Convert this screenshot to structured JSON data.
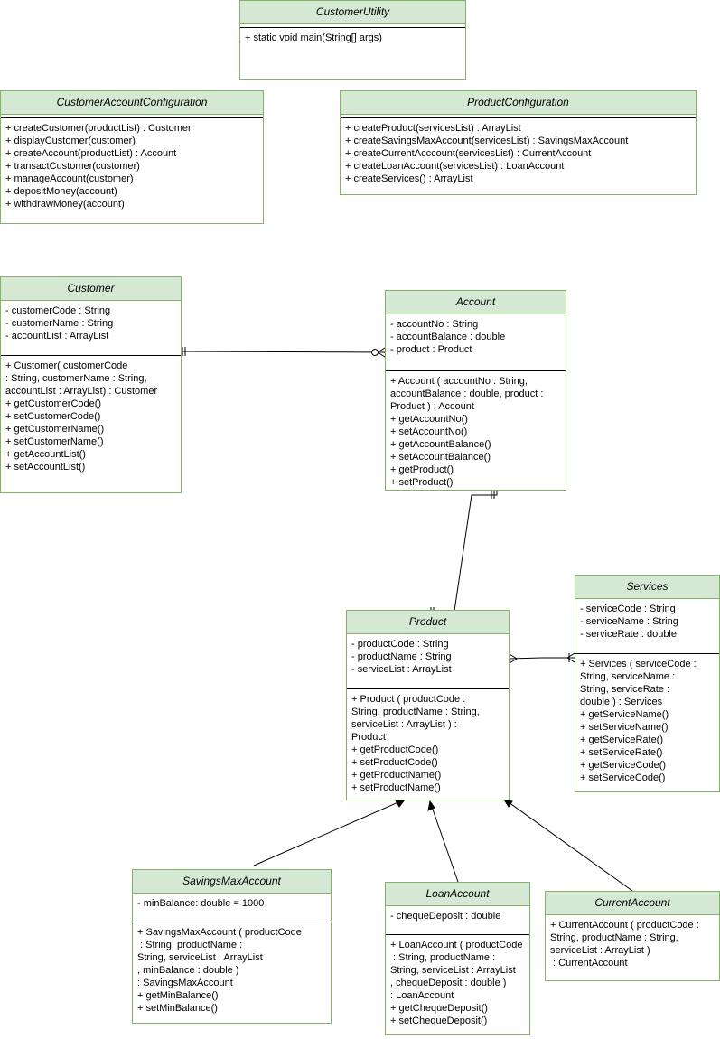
{
  "classes": {
    "customer_utility": {
      "name": "CustomerUtility",
      "attributes": [],
      "operations": [
        "+ static void main(String[] args)"
      ]
    },
    "customer_account_configuration": {
      "name": "CustomerAccountConfiguration",
      "attributes": [],
      "operations": [
        "+ createCustomer(productList) : Customer",
        "+ displayCustomer(customer)",
        "+ createAccount(productList) : Account",
        "+ transactCustomer(customer)",
        "+ manageAccount(customer)",
        "+ depositMoney(account)",
        "+ withdrawMoney(account)"
      ]
    },
    "product_configuration": {
      "name": "ProductConfiguration",
      "attributes": [],
      "operations": [
        "+ createProduct(servicesList) : ArrayList",
        "+ createSavingsMaxAccount(servicesList) : SavingsMaxAccount",
        "+ createCurrentAcccount(servicesList) : CurrentAccount",
        "+ createLoanAccount(servicesList) : LoanAccount",
        "+ createServices() : ArrayList"
      ]
    },
    "customer": {
      "name": "Customer",
      "attributes": [
        "- customerCode : String",
        "- customerName : String",
        "- accountList : ArrayList"
      ],
      "operations": [
        "+ Customer( customerCode",
        ": String, customerName : String,",
        "accountList : ArrayList) : Customer",
        "+ getCustomerCode()",
        "+ setCustomerCode()",
        "+ getCustomerName()",
        "+ setCustomerName()",
        "+ getAccountList()",
        "+ setAccountList()"
      ]
    },
    "account": {
      "name": "Account",
      "attributes": [
        "- accountNo : String",
        "- accountBalance : double",
        "- product : Product"
      ],
      "operations": [
        "+ Account ( accountNo : String,",
        "accountBalance : double, product :",
        "Product ) : Account",
        "+ getAccountNo()",
        "+ setAccountNo()",
        "+ getAccountBalance()",
        "+ setAccountBalance()",
        "+ getProduct()",
        "+ setProduct()"
      ]
    },
    "services": {
      "name": "Services",
      "attributes": [
        "- serviceCode : String",
        "- serviceName : String",
        "- serviceRate : double"
      ],
      "operations": [
        "+ Services ( serviceCode :",
        "String, serviceName :",
        "String, serviceRate :",
        "double ) : Services",
        "+ getServiceName()",
        "+ setServiceName()",
        "+ getServiceRate()",
        "+ setServiceRate()",
        "+ getServiceCode()",
        "+ setServiceCode()"
      ]
    },
    "product": {
      "name": "Product",
      "attributes": [
        "- productCode : String",
        "- productName : String",
        "- serviceList : ArrayList"
      ],
      "operations": [
        "+ Product ( productCode :",
        "String, productName : String,",
        "serviceList : ArrayList ) :",
        "Product",
        "+ getProductCode()",
        "+ setProductCode()",
        "+ getProductName()",
        "+ setProductName()"
      ]
    },
    "savings_max_account": {
      "name": "SavingsMaxAccount",
      "attributes": [
        "- minBalance: double = 1000"
      ],
      "operations": [
        "+ SavingsMaxAccount ( productCode",
        " : String, productName :",
        "String, serviceList : ArrayList",
        ", minBalance : double )",
        ": SavingsMaxAccount",
        "+ getMinBalance()",
        "+ setMinBalance()"
      ]
    },
    "loan_account": {
      "name": "LoanAccount",
      "attributes": [
        "- chequeDeposit : double"
      ],
      "operations": [
        "+ LoanAccount ( productCode",
        " : String, productName :",
        "String, serviceList : ArrayList",
        ", chequeDeposit : double )",
        ": LoanAccount",
        "+ getChequeDeposit()",
        "+ setChequeDeposit()"
      ]
    },
    "current_account": {
      "name": "CurrentAccount",
      "attributes": [],
      "operations": [
        "+ CurrentAccount ( productCode :",
        "String, productName : String,",
        "serviceList : ArrayList )",
        " : CurrentAccount"
      ]
    }
  },
  "relationships": [
    {
      "from": "Customer",
      "to": "Account",
      "from_end": "one-and-only-one",
      "to_end": "zero-or-many"
    },
    {
      "from": "Account",
      "to": "Product",
      "from_end": "one-and-only-one",
      "to_end": "one-and-only-one"
    },
    {
      "from": "Product",
      "to": "Services",
      "from_end": "many",
      "to_end": "one-or-many"
    },
    {
      "from": "SavingsMaxAccount",
      "to": "Product",
      "type": "generalization"
    },
    {
      "from": "LoanAccount",
      "to": "Product",
      "type": "generalization"
    },
    {
      "from": "CurrentAccount",
      "to": "Product",
      "type": "generalization"
    }
  ],
  "colors": {
    "header_fill": "#d5e8d4",
    "border": "#82b366",
    "line": "#000000"
  }
}
